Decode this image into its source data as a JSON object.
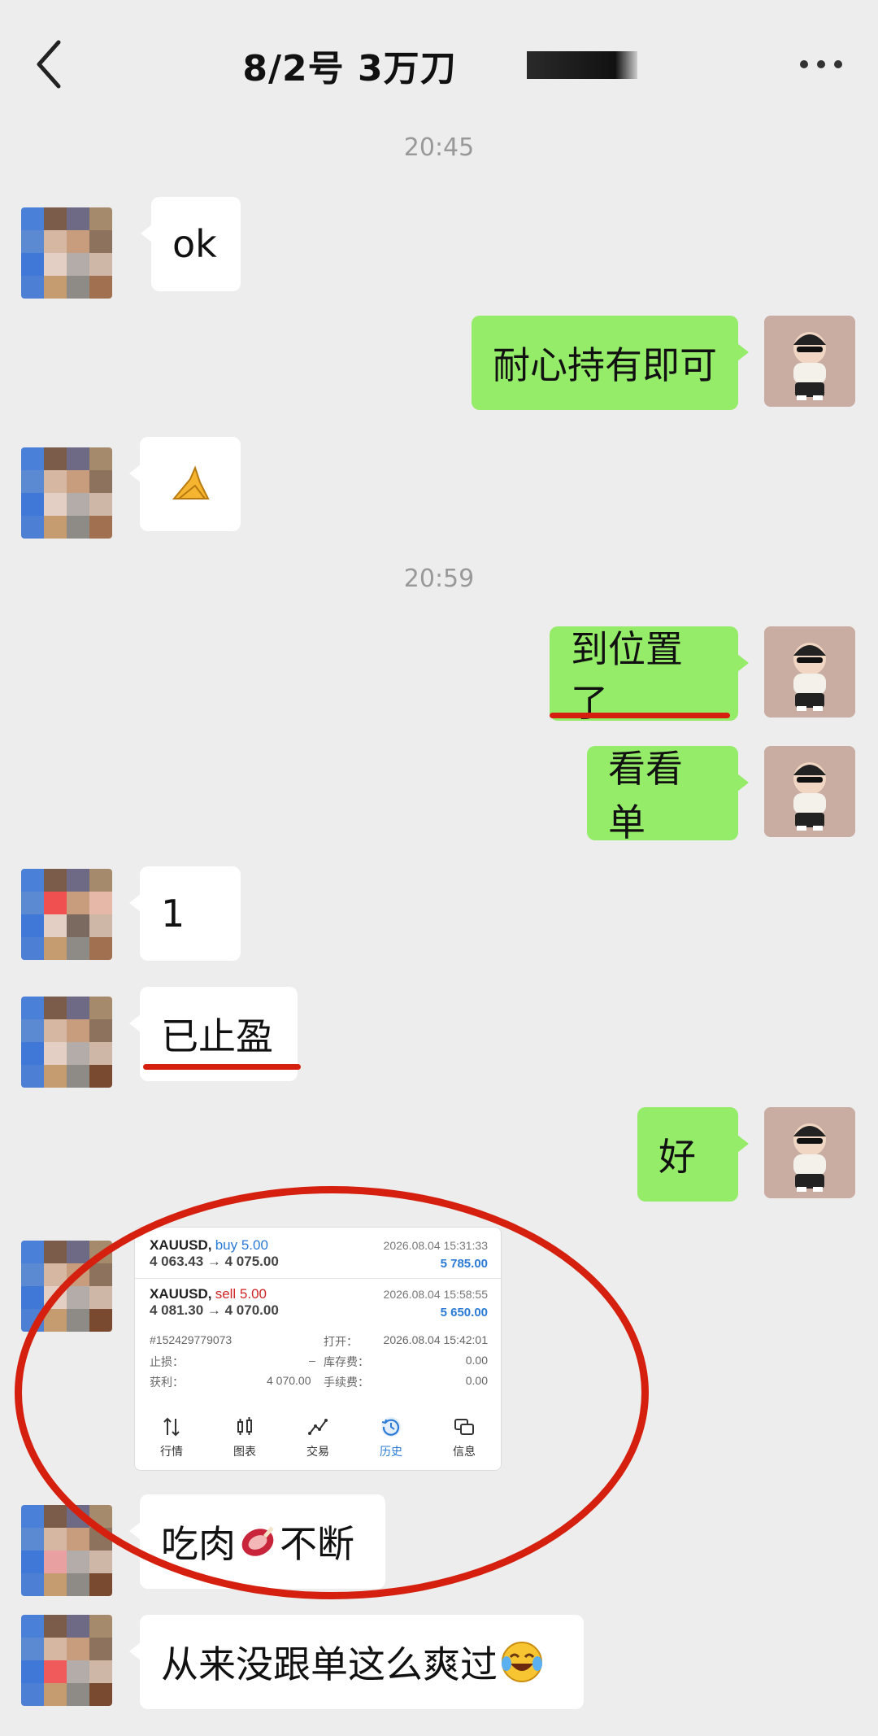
{
  "header": {
    "title": "8/2号 3万刀"
  },
  "timestamps": [
    "20:45",
    "20:59"
  ],
  "messages": {
    "m1": "ok",
    "m2": "耐心持有即可",
    "m4": "到位置了",
    "m5": "看看单",
    "m6": "1",
    "m7": "已止盈",
    "m8": "好",
    "m10a": "吃肉",
    "m10b": "不断",
    "m11": "从来没跟单这么爽过"
  },
  "trade_card": {
    "trade1": {
      "symbol": "XAUUSD,",
      "side": "buy 5.00",
      "prices": "4 063.43 → 4 075.00",
      "date": "2026.08.04 15:31:33",
      "profit": "5 785.00"
    },
    "trade2": {
      "symbol": "XAUUSD,",
      "side": "sell 5.00",
      "prices": "4 081.30 → 4 070.00",
      "date": "2026.08.04 15:58:55",
      "profit": "5 650.00"
    },
    "order_id": "#152429779073",
    "open_label": "打开：",
    "open_value": "2026.08.04 15:42:01",
    "sl_label": "止损：",
    "sl_value": "–",
    "swap_label": "库存费：",
    "swap_value": "0.00",
    "tp_label": "获利：",
    "tp_value": "4 070.00",
    "fee_label": "手续费：",
    "fee_value": "0.00",
    "nav": [
      "行情",
      "图表",
      "交易",
      "历史",
      "信息"
    ],
    "active_tab": "历史"
  },
  "colors": {
    "outgoing": "#95ec69",
    "incoming": "#ffffff",
    "annotation": "#d6200f",
    "background": "#ededed"
  },
  "icons": [
    "back-arrow-icon",
    "more-dots-icon",
    "pray-hands-emoji",
    "meat-emoji",
    "laugh-cry-emoji"
  ]
}
